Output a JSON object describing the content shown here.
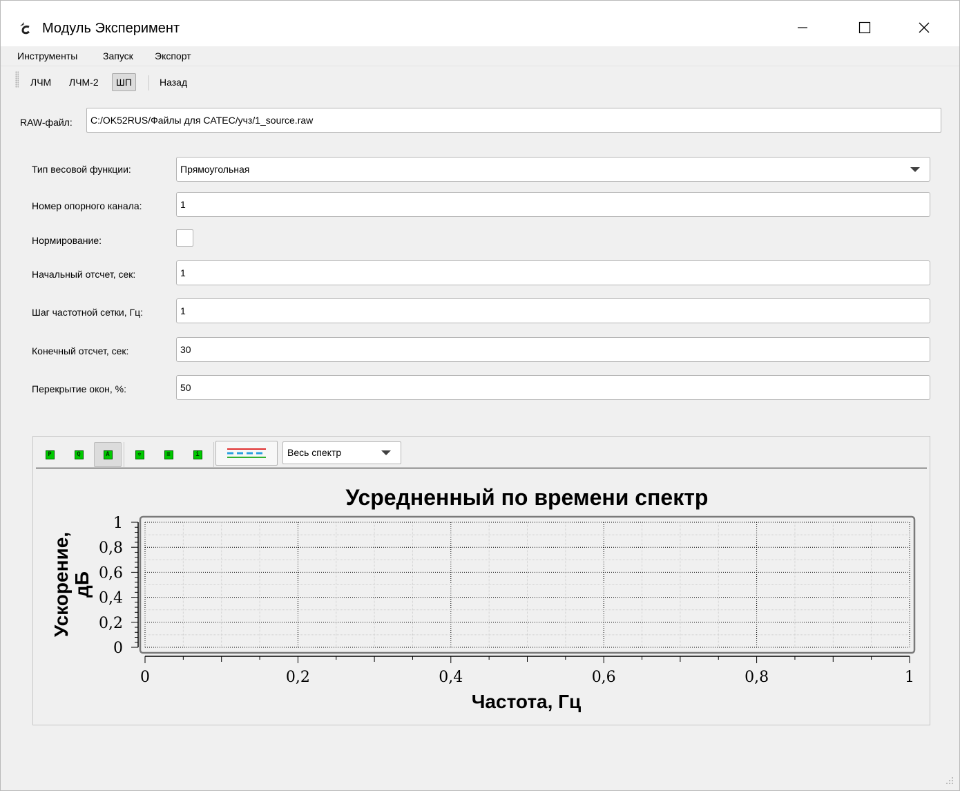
{
  "window": {
    "title": "Модуль Эксперимент",
    "minimize_symbol": "—",
    "maximize_symbol": "☐",
    "close_symbol": "✕"
  },
  "menu": [
    "Инструменты",
    "Запуск",
    "Экспорт"
  ],
  "toolbar": {
    "tabs": [
      "ЛЧМ",
      "ЛЧМ-2",
      "ШП",
      "Назад"
    ],
    "active_tab": "ШП"
  },
  "raw_file": {
    "label": "RAW-файл:",
    "value": "C:/OK52RUS/Файлы для CATEC/учз/1_source.raw"
  },
  "form": {
    "window_type": {
      "label": "Тип весовой функции:",
      "value": "Прямоугольная"
    },
    "ref_channel": {
      "label": "Номер опорного канала:",
      "value": "1"
    },
    "normalization": {
      "label": "Нормирование:",
      "checked": false
    },
    "start_sample": {
      "label": "Начальный отсчет, сек:",
      "value": "1"
    },
    "freq_step": {
      "label": "Шаг частотной сетки, Гц:",
      "value": "1"
    },
    "end_sample": {
      "label": "Конечный отсчет, сек:",
      "value": "30"
    },
    "overlap": {
      "label": "Перекрытие окон, %:",
      "value": "50"
    }
  },
  "plot_toolbar": {
    "icons": [
      "pan-icon",
      "zoom-icon",
      "autoscale-icon",
      "settings-icon",
      "print-icon",
      "info-icon"
    ],
    "active_icon": "autoscale-icon",
    "range_select": "Весь спектр",
    "legend_colors": [
      "#e03030",
      "#2aa0e0",
      "#30b030"
    ]
  },
  "chart_data": {
    "type": "line",
    "title": "Усредненный по времени спектр",
    "xlabel": "Частота, Гц",
    "ylabel_line1": "Ускорение,",
    "ylabel_line2": "дБ",
    "xlim": [
      0,
      1
    ],
    "ylim": [
      0,
      1
    ],
    "x_ticks": [
      "0",
      "0,2",
      "0,4",
      "0,6",
      "0,8",
      "1"
    ],
    "y_ticks": [
      "0",
      "0,2",
      "0,4",
      "0,6",
      "0,8",
      "1"
    ],
    "grid": true,
    "series": []
  }
}
